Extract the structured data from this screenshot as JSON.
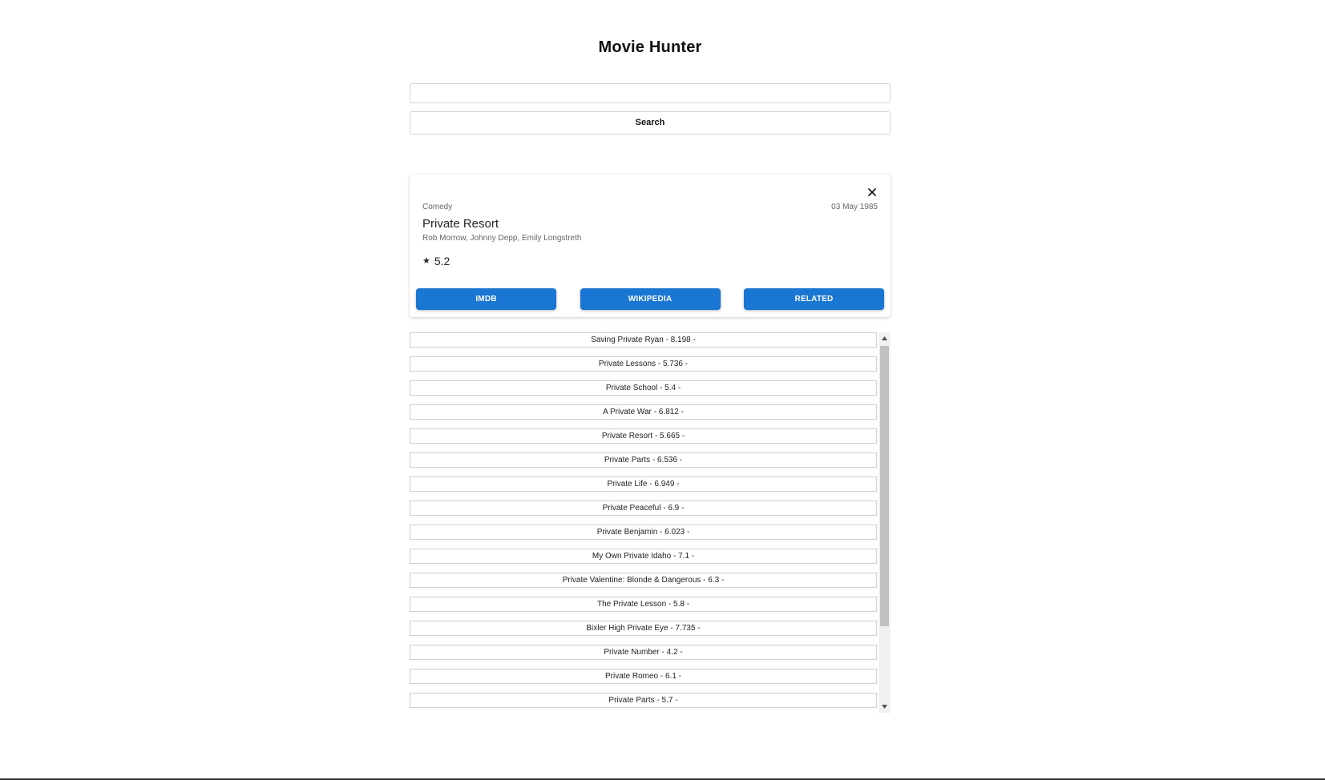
{
  "app": {
    "title": "Movie Hunter"
  },
  "search": {
    "value": "",
    "button_label": "Search"
  },
  "card": {
    "genre": "Comedy",
    "date": "03 May 1985",
    "title": "Private Resort",
    "cast": "Rob Morrow, Johnny Depp, Emily Longstreth",
    "star_icon": "★",
    "rating": "5.2",
    "close_icon": "close-icon",
    "actions": [
      "IMDB",
      "WIKIPEDIA",
      "RELATED"
    ],
    "accent_color": "#1976d2"
  },
  "results": [
    "Saving Private Ryan - 8.198 -",
    "Private Lessons - 5.736 -",
    "Private School - 5.4 -",
    "A Private War - 6.812 -",
    "Private Resort - 5.665 -",
    "Private Parts - 6.536 -",
    "Private Life - 6.949 -",
    "Private Peaceful - 6.9 -",
    "Private Benjamin - 6.023 -",
    "My Own Private Idaho - 7.1 -",
    "Private Valentine: Blonde & Dangerous - 6.3 -",
    "The Private Lesson - 5.8 -",
    "Bixler High Private Eye - 7.735 -",
    "Private Number - 4.2 -",
    "Private Romeo - 6.1 -",
    "Private Parts - 5.7 -"
  ]
}
